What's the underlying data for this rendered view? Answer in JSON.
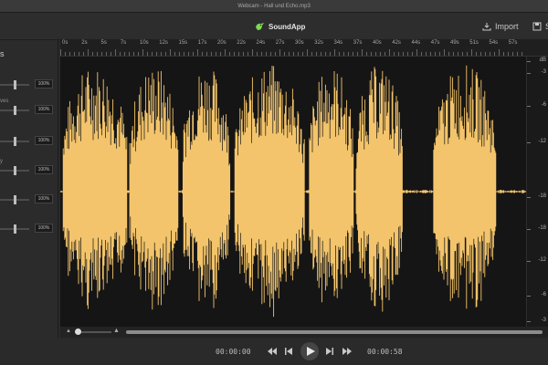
{
  "window": {
    "title": "Webcam - Hall und Echo.mp3"
  },
  "header": {
    "brand_name": "SoundApp",
    "import_label": "Import",
    "save_label": "S",
    "brand_color": "#7ed957"
  },
  "sidebar": {
    "title": "s",
    "rows": [
      {
        "label": "",
        "value": "100%",
        "level": 0.5
      },
      {
        "label": "ves",
        "value": "100%",
        "level": 0.5
      },
      {
        "label": "",
        "value": "100%",
        "level": 0.5
      },
      {
        "label": "y",
        "value": "100%",
        "level": 0.5
      },
      {
        "label": "",
        "value": "100%",
        "level": 0.5
      },
      {
        "label": "",
        "value": "100%",
        "level": 0.5
      }
    ]
  },
  "timeline": {
    "ticks": [
      "0s",
      "2s",
      "5s",
      "7s",
      "10s",
      "12s",
      "15s",
      "17s",
      "20s",
      "22s",
      "24s",
      "27s",
      "30s",
      "32s",
      "34s",
      "37s",
      "40s",
      "42s",
      "44s",
      "47s",
      "49s",
      "51s",
      "54s",
      "57s"
    ]
  },
  "db_scale": {
    "unit": "dB",
    "labels": [
      "-3",
      "-6",
      "-12",
      "-18",
      "-18",
      "-12",
      "-6",
      "-3"
    ]
  },
  "waveform": {
    "color": "#f3c46b",
    "background": "#151515"
  },
  "transport": {
    "current_time": "00:00:00",
    "total_time": "00:00:58",
    "zoom_level": 0
  }
}
